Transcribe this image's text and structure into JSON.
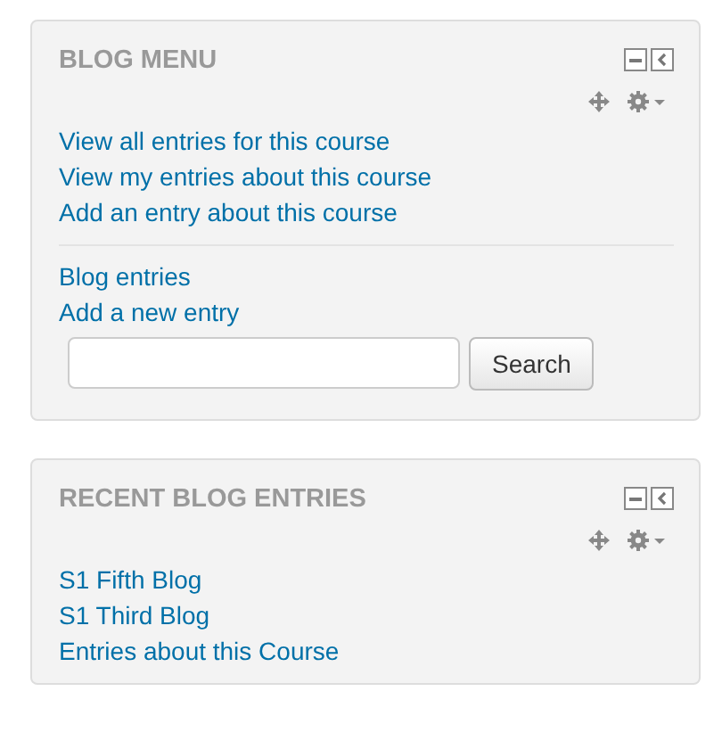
{
  "blocks": [
    {
      "title": "BLOG MENU",
      "groups": [
        [
          "View all entries for this course",
          "View my entries about this course",
          "Add an entry about this course"
        ],
        [
          "Blog entries",
          "Add a new entry"
        ]
      ],
      "search": {
        "button": "Search"
      }
    },
    {
      "title": "RECENT BLOG ENTRIES",
      "groups": [
        [
          "S1 Fifth Blog",
          "S1 Third Blog",
          "Entries about this Course"
        ]
      ]
    }
  ]
}
